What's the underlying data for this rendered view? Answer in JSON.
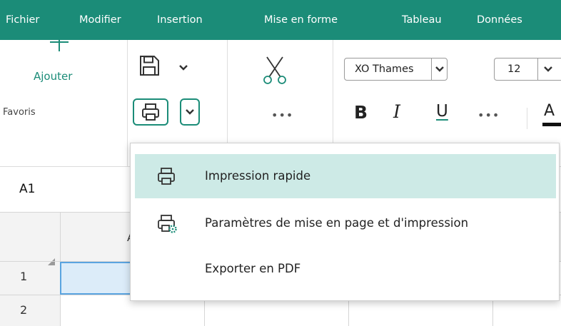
{
  "menubar": {
    "items": [
      {
        "label": "Fichier"
      },
      {
        "label": "Modifier"
      },
      {
        "label": "Insertion"
      },
      {
        "label": "Mise en forme"
      },
      {
        "label": "Tableau"
      },
      {
        "label": "Données"
      }
    ]
  },
  "ribbon": {
    "add_label": "Ajouter",
    "group_label": "Favoris",
    "font_name": "XO Thames",
    "font_size": "12",
    "bold_label": "B",
    "italic_label": "I",
    "underline_label": "U",
    "more_label": "•••",
    "color_letter": "A"
  },
  "sheet": {
    "cell_ref": "A1",
    "columns": [
      "A"
    ],
    "rows": [
      "1",
      "2"
    ]
  },
  "print_menu": {
    "items": [
      {
        "label": "Impression rapide",
        "icon": "printer-icon",
        "selected": true
      },
      {
        "label": "Paramètres de mise en page et d'impression",
        "icon": "printer-settings-icon",
        "selected": false
      },
      {
        "label": "Exporter en PDF",
        "icon": "",
        "selected": false
      }
    ]
  },
  "colors": {
    "accent": "#1b8c78",
    "selected_item": "#cdeae6",
    "cell_selection": "#dcecf9",
    "cell_border": "#5aa4e0"
  }
}
